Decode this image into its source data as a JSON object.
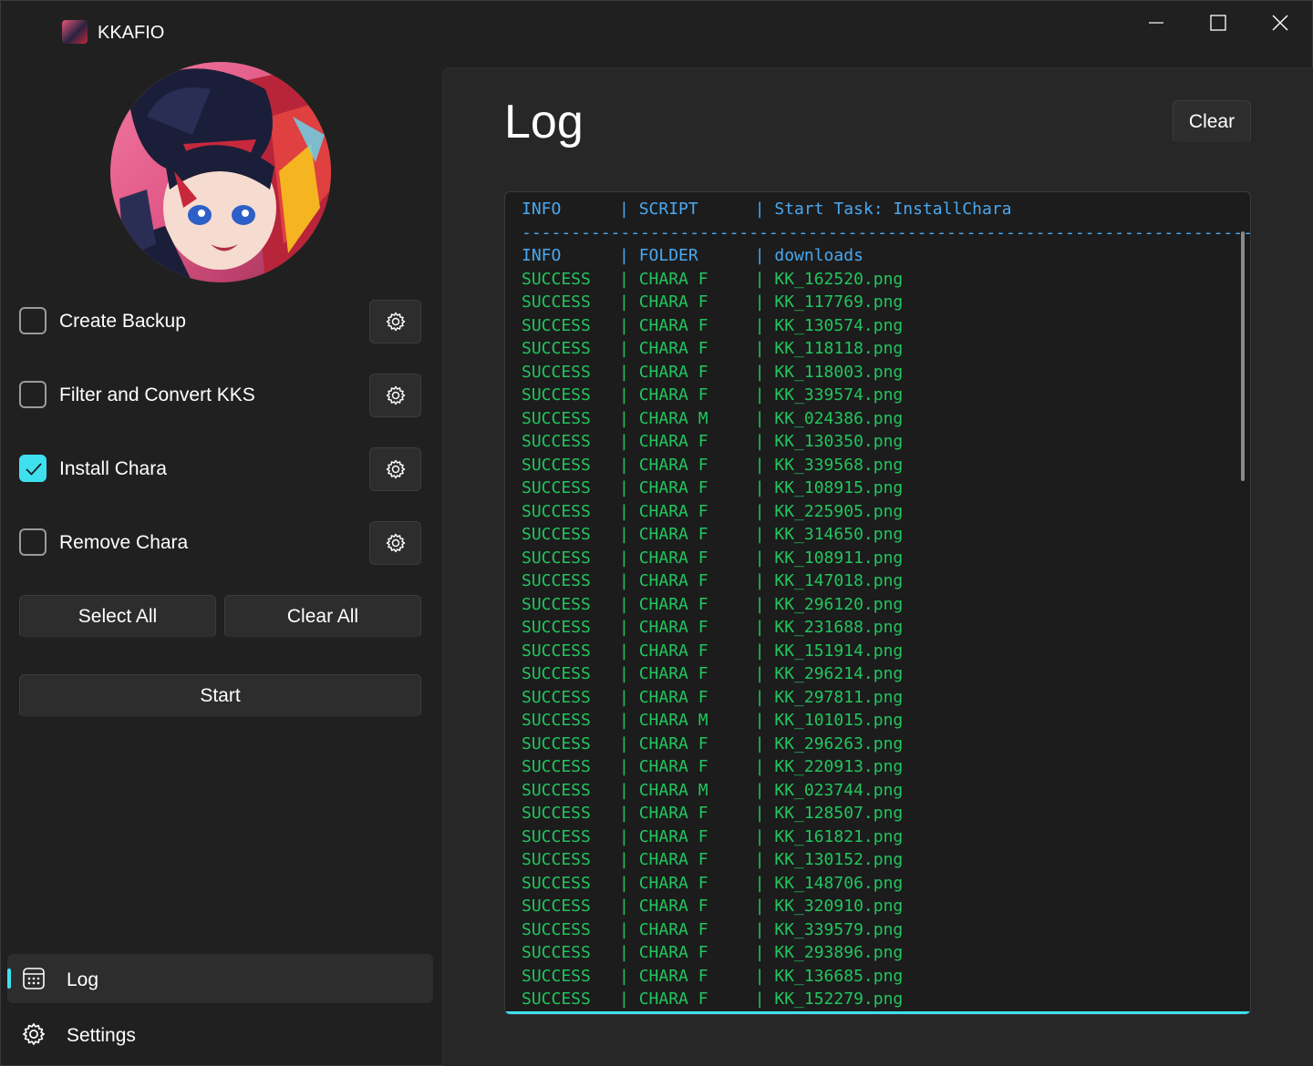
{
  "app": {
    "title": "KKAFIO"
  },
  "tasks": [
    {
      "label": "Create Backup",
      "checked": false
    },
    {
      "label": "Filter and Convert KKS",
      "checked": false
    },
    {
      "label": "Install Chara",
      "checked": true
    },
    {
      "label": "Remove Chara",
      "checked": false
    }
  ],
  "buttons": {
    "select_all": "Select All",
    "clear_all": "Clear All",
    "start": "Start",
    "clear_log": "Clear"
  },
  "nav": {
    "log": "Log",
    "settings": "Settings"
  },
  "page": {
    "title": "Log"
  },
  "log": {
    "lines": [
      {
        "level": "INFO",
        "source": "SCRIPT",
        "message": "Start Task: InstallChara",
        "kind": "info"
      },
      {
        "kind": "sep",
        "text": "-----------------------------------------------------------------------------"
      },
      {
        "level": "INFO",
        "source": "FOLDER",
        "message": "downloads",
        "kind": "info"
      },
      {
        "level": "SUCCESS",
        "source": "CHARA F",
        "message": "KK_162520.png",
        "kind": "success"
      },
      {
        "level": "SUCCESS",
        "source": "CHARA F",
        "message": "KK_117769.png",
        "kind": "success"
      },
      {
        "level": "SUCCESS",
        "source": "CHARA F",
        "message": "KK_130574.png",
        "kind": "success"
      },
      {
        "level": "SUCCESS",
        "source": "CHARA F",
        "message": "KK_118118.png",
        "kind": "success"
      },
      {
        "level": "SUCCESS",
        "source": "CHARA F",
        "message": "KK_118003.png",
        "kind": "success"
      },
      {
        "level": "SUCCESS",
        "source": "CHARA F",
        "message": "KK_339574.png",
        "kind": "success"
      },
      {
        "level": "SUCCESS",
        "source": "CHARA M",
        "message": "KK_024386.png",
        "kind": "success"
      },
      {
        "level": "SUCCESS",
        "source": "CHARA F",
        "message": "KK_130350.png",
        "kind": "success"
      },
      {
        "level": "SUCCESS",
        "source": "CHARA F",
        "message": "KK_339568.png",
        "kind": "success"
      },
      {
        "level": "SUCCESS",
        "source": "CHARA F",
        "message": "KK_108915.png",
        "kind": "success"
      },
      {
        "level": "SUCCESS",
        "source": "CHARA F",
        "message": "KK_225905.png",
        "kind": "success"
      },
      {
        "level": "SUCCESS",
        "source": "CHARA F",
        "message": "KK_314650.png",
        "kind": "success"
      },
      {
        "level": "SUCCESS",
        "source": "CHARA F",
        "message": "KK_108911.png",
        "kind": "success"
      },
      {
        "level": "SUCCESS",
        "source": "CHARA F",
        "message": "KK_147018.png",
        "kind": "success"
      },
      {
        "level": "SUCCESS",
        "source": "CHARA F",
        "message": "KK_296120.png",
        "kind": "success"
      },
      {
        "level": "SUCCESS",
        "source": "CHARA F",
        "message": "KK_231688.png",
        "kind": "success"
      },
      {
        "level": "SUCCESS",
        "source": "CHARA F",
        "message": "KK_151914.png",
        "kind": "success"
      },
      {
        "level": "SUCCESS",
        "source": "CHARA F",
        "message": "KK_296214.png",
        "kind": "success"
      },
      {
        "level": "SUCCESS",
        "source": "CHARA F",
        "message": "KK_297811.png",
        "kind": "success"
      },
      {
        "level": "SUCCESS",
        "source": "CHARA M",
        "message": "KK_101015.png",
        "kind": "success"
      },
      {
        "level": "SUCCESS",
        "source": "CHARA F",
        "message": "KK_296263.png",
        "kind": "success"
      },
      {
        "level": "SUCCESS",
        "source": "CHARA F",
        "message": "KK_220913.png",
        "kind": "success"
      },
      {
        "level": "SUCCESS",
        "source": "CHARA M",
        "message": "KK_023744.png",
        "kind": "success"
      },
      {
        "level": "SUCCESS",
        "source": "CHARA F",
        "message": "KK_128507.png",
        "kind": "success"
      },
      {
        "level": "SUCCESS",
        "source": "CHARA F",
        "message": "KK_161821.png",
        "kind": "success"
      },
      {
        "level": "SUCCESS",
        "source": "CHARA F",
        "message": "KK_130152.png",
        "kind": "success"
      },
      {
        "level": "SUCCESS",
        "source": "CHARA F",
        "message": "KK_148706.png",
        "kind": "success"
      },
      {
        "level": "SUCCESS",
        "source": "CHARA F",
        "message": "KK_320910.png",
        "kind": "success"
      },
      {
        "level": "SUCCESS",
        "source": "CHARA F",
        "message": "KK_339579.png",
        "kind": "success"
      },
      {
        "level": "SUCCESS",
        "source": "CHARA F",
        "message": "KK_293896.png",
        "kind": "success"
      },
      {
        "level": "SUCCESS",
        "source": "CHARA F",
        "message": "KK_136685.png",
        "kind": "success"
      },
      {
        "level": "SUCCESS",
        "source": "CHARA F",
        "message": "KK_152279.png",
        "kind": "success"
      }
    ]
  },
  "colors": {
    "accent": "#3ee0f0",
    "info": "#4aa8f0",
    "success": "#22c55e",
    "background": "#202020",
    "content": "#272727"
  },
  "icons": {
    "window_min": "minimize-icon",
    "window_max": "maximize-icon",
    "window_close": "close-icon",
    "gear": "gear-icon",
    "log": "calendar-grid-icon",
    "settings": "gear-icon"
  }
}
